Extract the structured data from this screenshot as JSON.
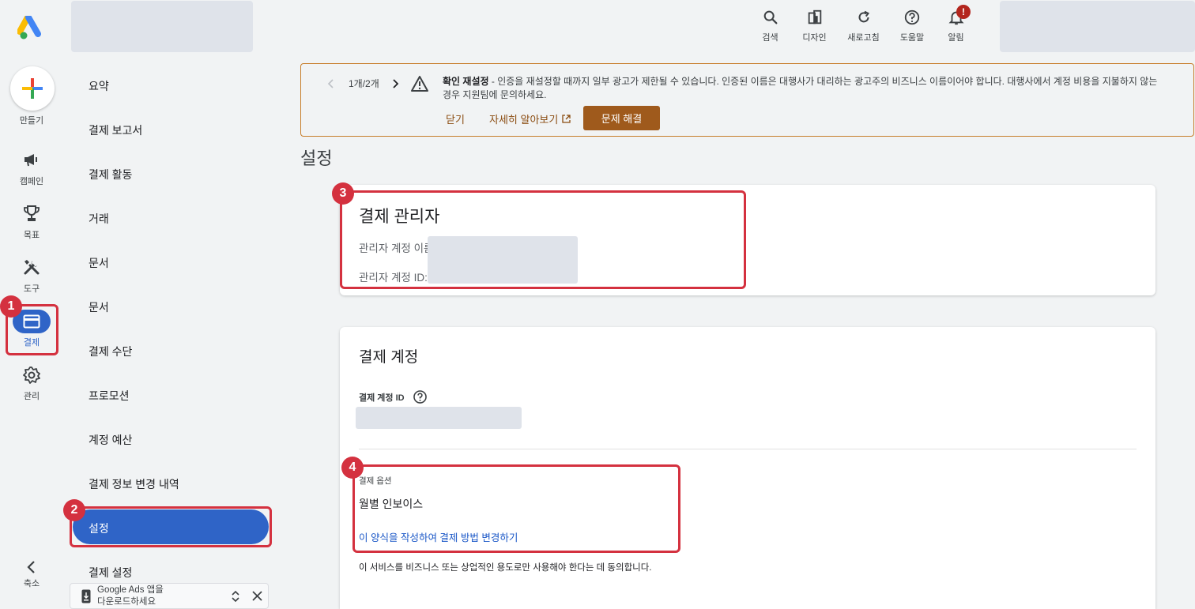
{
  "topbar": {
    "actions": [
      {
        "label": "검색",
        "icon": "search-icon"
      },
      {
        "label": "디자인",
        "icon": "design-icon"
      },
      {
        "label": "새로고침",
        "icon": "refresh-icon"
      },
      {
        "label": "도움말",
        "icon": "help-icon"
      },
      {
        "label": "알림",
        "icon": "bell-icon"
      }
    ],
    "alert_badge": "!"
  },
  "rail": {
    "create": "만들기",
    "campaign": "캠페인",
    "goals": "목표",
    "tools": "도구",
    "billing": "결제",
    "admin": "관리",
    "collapse": "축소"
  },
  "subnav": {
    "items": [
      "요약",
      "결제 보고서",
      "결제 활동",
      "거래",
      "문서",
      "문서",
      "결제 수단",
      "프로모션",
      "계정 예산",
      "결제 정보 변경 내역"
    ],
    "active": "설정",
    "after": "결제 설정"
  },
  "download": {
    "line1": "Google Ads 앱을",
    "line2": "다운로드하세요"
  },
  "banner": {
    "pager": "1개/2개",
    "heading": "확인 재설정",
    "message": " - 인증을 재설정할 때까지 일부 광고가 제한될 수 있습니다. 인증된 이름은 대행사가 대리하는 광고주의 비즈니스 이름이어야 합니다. 대행사에서 계정 비용을 지불하지 않는 경우 지원팀에 문의하세요.",
    "close": "닫기",
    "learn_more": "자세히 알아보기",
    "fix": "문제 해결"
  },
  "page": {
    "title": "설정"
  },
  "manager": {
    "title": "결제 관리자",
    "name_label": "관리자 계정 이름",
    "id_label": "관리자 계정 ID:"
  },
  "billing_account": {
    "title": "결제 계정",
    "id_label": "결제 계정 ID",
    "options_label": "결제 옵션",
    "option_value": "월별 인보이스",
    "change_link": "이 양식을 작성하여 결제 방법 변경하기",
    "consent": "이 서비스를 비즈니스 또는 상업적인 용도로만 사용해야 한다는 데 동의합니다."
  },
  "annotations": {
    "b1": "1",
    "b2": "2",
    "b3": "3",
    "b4": "4"
  },
  "colors": {
    "accent": "#2f64c7",
    "highlight": "#d4313f",
    "warning": "#9f5a1c"
  }
}
